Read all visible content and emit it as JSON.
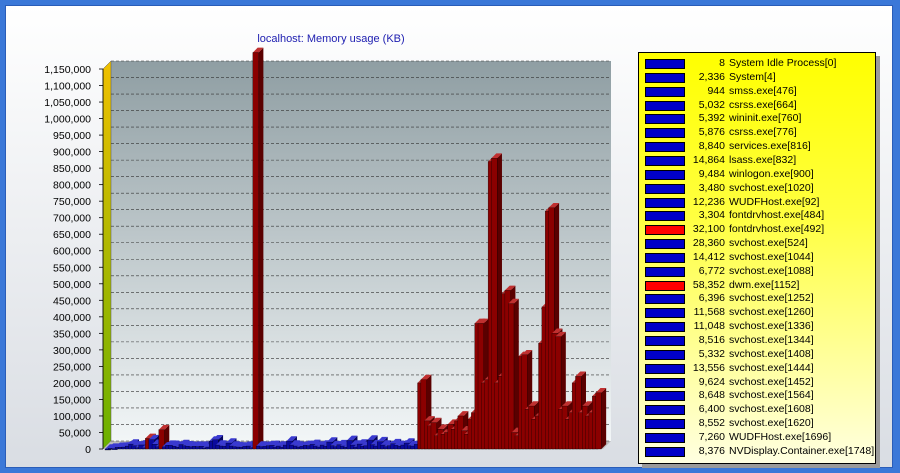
{
  "chart_data": {
    "type": "bar",
    "title": "localhost: Memory usage (KB)",
    "ylim": [
      0,
      1150000
    ],
    "yticks": [
      "0",
      "50,000",
      "100,000",
      "150,000",
      "200,000",
      "250,000",
      "300,000",
      "350,000",
      "400,000",
      "450,000",
      "500,000",
      "550,000",
      "600,000",
      "650,000",
      "700,000",
      "750,000",
      "800,000",
      "850,000",
      "900,000",
      "950,000",
      "1,000,000",
      "1,050,000",
      "1,100,000",
      "1,150,000"
    ],
    "grid": true,
    "legend_position": "right",
    "colors": {
      "low": "#0a0a9e",
      "high": "#8b0000",
      "legend_red": "#ff0000",
      "legend_blue": "#0000c8"
    },
    "values": [
      8,
      2336,
      944,
      5032,
      5392,
      5876,
      8840,
      14864,
      9484,
      3480,
      12236,
      3304,
      32100,
      28360,
      14412,
      6772,
      58352,
      6396,
      11568,
      11048,
      8516,
      5332,
      13556,
      9624,
      8648,
      6400,
      8552,
      7260,
      8376,
      3000,
      6000,
      24000,
      28000,
      12000,
      9000,
      8000,
      18000,
      9000,
      7000,
      6000,
      5000,
      8000,
      9000,
      4000,
      1200000,
      9000,
      7000,
      8000,
      10000,
      11000,
      6000,
      9000,
      5000,
      12000,
      24000,
      12000,
      9000,
      6000,
      8000,
      11000,
      10000,
      14000,
      9000,
      6000,
      12000,
      8000,
      21000,
      10000,
      7000,
      13000,
      9000,
      5000,
      26000,
      12000,
      6000,
      15000,
      8000,
      10000,
      27000,
      13000,
      9000,
      22000,
      12000,
      7000,
      10000,
      16000,
      11000,
      8000,
      12000,
      18000,
      10000,
      9000,
      14000,
      200000,
      210000,
      85000,
      70000,
      80000,
      40000,
      60000,
      45000,
      50000,
      75000,
      60000,
      85000,
      100000,
      55000,
      45000,
      90000,
      110000,
      380000,
      380000,
      200000,
      210000,
      870000,
      880000,
      200000,
      220000,
      470000,
      480000,
      440000,
      50000,
      40000,
      280000,
      285000,
      120000,
      130000,
      90000,
      100000,
      320000,
      430000,
      720000,
      730000,
      350000,
      340000,
      120000,
      130000,
      90000,
      110000,
      200000,
      220000,
      110000,
      130000,
      100000,
      110000,
      160000,
      170000
    ],
    "series_legend": [
      {
        "value": "8",
        "name": "System Idle Process[0]",
        "color": "blue"
      },
      {
        "value": "2,336",
        "name": "System[4]",
        "color": "blue"
      },
      {
        "value": "944",
        "name": "smss.exe[476]",
        "color": "blue"
      },
      {
        "value": "5,032",
        "name": "csrss.exe[664]",
        "color": "blue"
      },
      {
        "value": "5,392",
        "name": "wininit.exe[760]",
        "color": "blue"
      },
      {
        "value": "5,876",
        "name": "csrss.exe[776]",
        "color": "blue"
      },
      {
        "value": "8,840",
        "name": "services.exe[816]",
        "color": "blue"
      },
      {
        "value": "14,864",
        "name": "lsass.exe[832]",
        "color": "blue"
      },
      {
        "value": "9,484",
        "name": "winlogon.exe[900]",
        "color": "blue"
      },
      {
        "value": "3,480",
        "name": "svchost.exe[1020]",
        "color": "blue"
      },
      {
        "value": "12,236",
        "name": "WUDFHost.exe[92]",
        "color": "blue"
      },
      {
        "value": "3,304",
        "name": "fontdrvhost.exe[484]",
        "color": "blue"
      },
      {
        "value": "32,100",
        "name": "fontdrvhost.exe[492]",
        "color": "red"
      },
      {
        "value": "28,360",
        "name": "svchost.exe[524]",
        "color": "blue"
      },
      {
        "value": "14,412",
        "name": "svchost.exe[1044]",
        "color": "blue"
      },
      {
        "value": "6,772",
        "name": "svchost.exe[1088]",
        "color": "blue"
      },
      {
        "value": "58,352",
        "name": "dwm.exe[1152]",
        "color": "red"
      },
      {
        "value": "6,396",
        "name": "svchost.exe[1252]",
        "color": "blue"
      },
      {
        "value": "11,568",
        "name": "svchost.exe[1260]",
        "color": "blue"
      },
      {
        "value": "11,048",
        "name": "svchost.exe[1336]",
        "color": "blue"
      },
      {
        "value": "8,516",
        "name": "svchost.exe[1344]",
        "color": "blue"
      },
      {
        "value": "5,332",
        "name": "svchost.exe[1408]",
        "color": "blue"
      },
      {
        "value": "13,556",
        "name": "svchost.exe[1444]",
        "color": "blue"
      },
      {
        "value": "9,624",
        "name": "svchost.exe[1452]",
        "color": "blue"
      },
      {
        "value": "8,648",
        "name": "svchost.exe[1564]",
        "color": "blue"
      },
      {
        "value": "6,400",
        "name": "svchost.exe[1608]",
        "color": "blue"
      },
      {
        "value": "8,552",
        "name": "svchost.exe[1620]",
        "color": "blue"
      },
      {
        "value": "7,260",
        "name": "WUDFHost.exe[1696]",
        "color": "blue"
      },
      {
        "value": "8,376",
        "name": "NVDisplay.Container.exe[1748]",
        "color": "blue"
      }
    ]
  }
}
